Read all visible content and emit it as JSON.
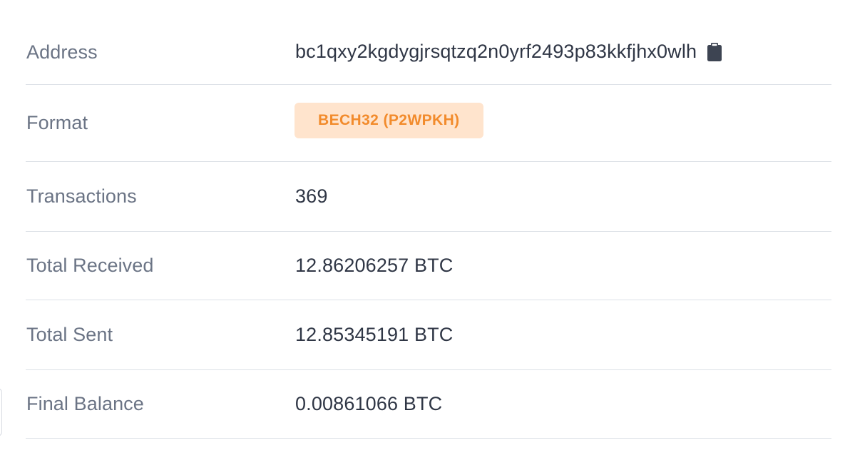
{
  "details": {
    "address": {
      "label": "Address",
      "value": "bc1qxy2kgdygjrsqtzq2n0yrf2493p83kkfjhx0wlh",
      "copy_icon": "clipboard-icon"
    },
    "format": {
      "label": "Format",
      "value": "BECH32 (P2WPKH)"
    },
    "transactions": {
      "label": "Transactions",
      "value": "369"
    },
    "total_received": {
      "label": "Total Received",
      "value": "12.86206257 BTC"
    },
    "total_sent": {
      "label": "Total Sent",
      "value": "12.85345191 BTC"
    },
    "final_balance": {
      "label": "Final Balance",
      "value": "0.00861066 BTC"
    }
  },
  "colors": {
    "label_text": "#6b7485",
    "value_text": "#2f3645",
    "badge_bg": "#ffe4cd",
    "badge_text": "#f28b2c",
    "divider": "#dde1e7"
  }
}
